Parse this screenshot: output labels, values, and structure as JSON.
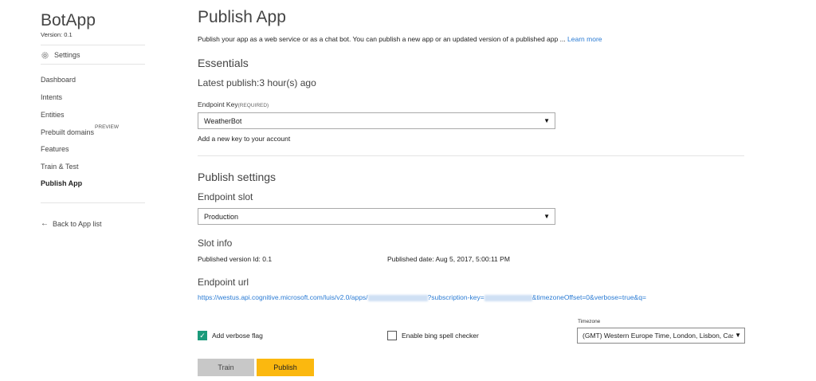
{
  "sidebar": {
    "app_name": "BotApp",
    "version_label": "Version:",
    "version_value": "0.1",
    "settings_label": "Settings",
    "items": [
      {
        "label": "Dashboard",
        "badge": ""
      },
      {
        "label": "Intents",
        "badge": ""
      },
      {
        "label": "Entities",
        "badge": ""
      },
      {
        "label": "Prebuilt domains",
        "badge": "PREVIEW"
      },
      {
        "label": "Features",
        "badge": ""
      },
      {
        "label": "Train & Test",
        "badge": ""
      },
      {
        "label": "Publish App",
        "badge": "",
        "active": true
      }
    ],
    "back_label": "Back to App list"
  },
  "main": {
    "title": "Publish App",
    "description": "Publish your app as a web service or as a chat bot. You can publish a new app or an updated version of a published app ...",
    "learn_more": "Learn more",
    "essentials": {
      "heading": "Essentials",
      "latest_publish": "Latest publish:3 hour(s) ago",
      "endpoint_key_label": "Endpoint Key",
      "endpoint_key_required": "(REQUIRED)",
      "endpoint_key_value": "WeatherBot",
      "add_key_link": "Add a new key to your account"
    },
    "publish_settings": {
      "heading": "Publish settings",
      "endpoint_slot_label": "Endpoint slot",
      "endpoint_slot_value": "Production",
      "slot_info_heading": "Slot info",
      "published_version": "Published version Id: 0.1",
      "published_date": "Published date: Aug 5, 2017, 5:00:11 PM",
      "endpoint_url_heading": "Endpoint url",
      "url_part1": "https://westus.api.cognitive.microsoft.com/luis/v2.0/apps/",
      "url_part2": "?subscription-key=",
      "url_part3": "&timezoneOffset=0&verbose=true&q="
    },
    "options": {
      "verbose_label": "Add verbose flag",
      "verbose_checked": true,
      "spell_label": "Enable bing spell checker",
      "spell_checked": false,
      "timezone_label": "Timezone",
      "timezone_value": "(GMT) Western Europe Time, London, Lisbon, Casablanca"
    },
    "buttons": {
      "train": "Train",
      "publish": "Publish"
    }
  },
  "colors": {
    "link": "#2a7bd4",
    "publish_button": "#fbb80f",
    "train_button": "#c8c8c8",
    "checkbox_checked": "#1b9b7b"
  },
  "icons": {
    "settings": "gear-icon",
    "back": "arrow-left-icon",
    "dropdown": "caret-down-icon",
    "check": "checkmark-icon"
  }
}
